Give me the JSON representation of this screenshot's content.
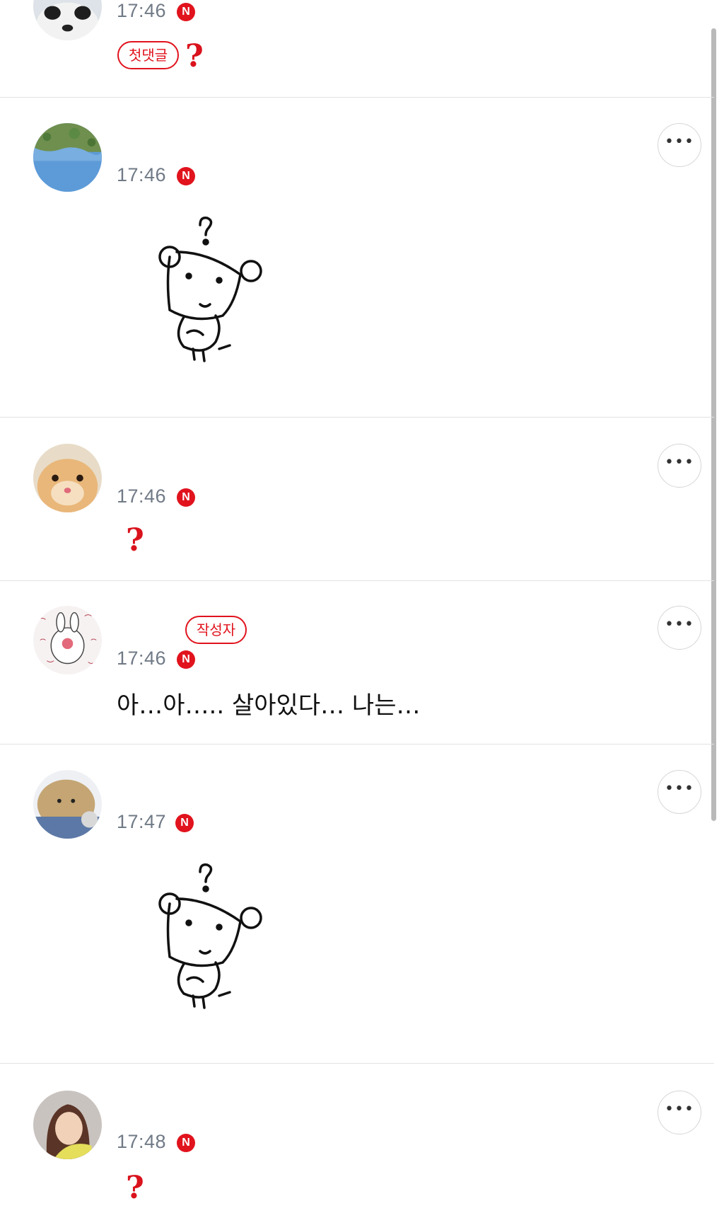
{
  "comments": [
    {
      "time": "17:46",
      "new_badge": "N",
      "tag": "첫댓글",
      "body": "?"
    },
    {
      "time": "17:46",
      "new_badge": "N",
      "body": ""
    },
    {
      "time": "17:46",
      "new_badge": "N",
      "body": "?"
    },
    {
      "time": "17:46",
      "new_badge": "N",
      "tag": "작성자",
      "body": "아…아….. 살아있다… 나는…"
    },
    {
      "time": "17:47",
      "new_badge": "N",
      "body": ""
    },
    {
      "time": "17:48",
      "new_badge": "N",
      "body": "?"
    }
  ],
  "more_button_label": "•••",
  "colors": {
    "accent": "#e1131d",
    "time": "#707a86",
    "divider": "#e2e2e2"
  },
  "icons": {
    "more": "more-options-icon",
    "new": "new-badge-icon"
  }
}
